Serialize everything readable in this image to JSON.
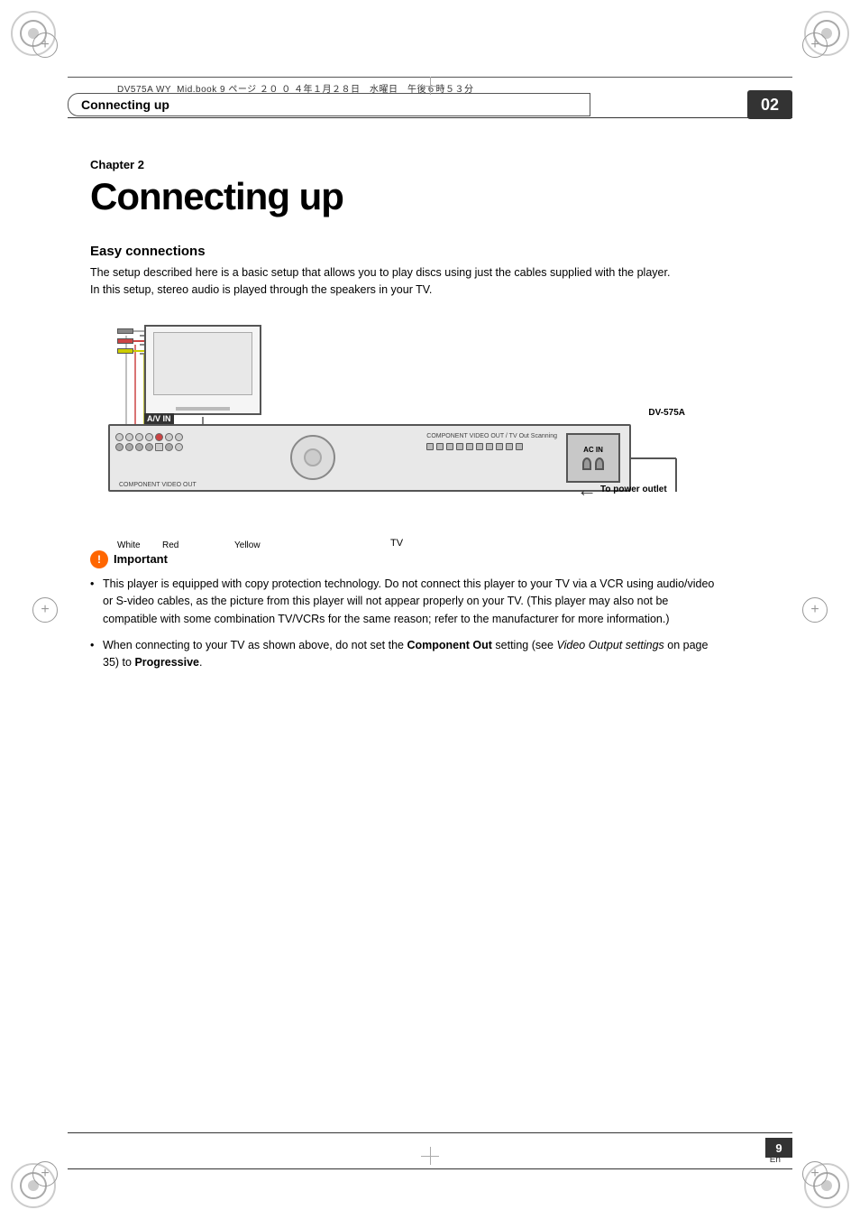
{
  "page": {
    "title": "Connecting up",
    "chapter_label": "Chapter 2",
    "chapter_title": "Connecting up",
    "chapter_number": "02",
    "page_number": "9",
    "page_lang": "En"
  },
  "header": {
    "file_info": "DV575A WY_Mid.book  9 ページ  ２０ ０ ４年１月２８日　水曜日　午後６時５３分",
    "section_title": "Connecting up",
    "chapter_badge": "02"
  },
  "easy_connections": {
    "title": "Easy connections",
    "body": "The setup described here is a basic setup that allows you to play discs using just the cables supplied with the player. In this setup, stereo audio is played through the speakers in your TV."
  },
  "diagram": {
    "tv_label": "TV",
    "av_in_label": "A/V IN",
    "dvd_label": "DV-575A",
    "wire_white": "White",
    "wire_red": "Red",
    "wire_yellow": "Yellow",
    "power_label": "To power\noutlet",
    "ac_in_label": "AC IN"
  },
  "important": {
    "title": "Important",
    "bullet1": "This player is equipped with copy protection technology. Do not connect this player to your TV via a VCR using audio/video or S-video cables, as the picture from this player will not appear properly on your TV. (This player may also not be compatible with some combination TV/VCRs for the same reason; refer to the manufacturer for more information.)",
    "bullet2_pre": "When connecting to your TV as shown above, do not set the ",
    "bullet2_bold": "Component Out",
    "bullet2_mid": " setting (see ",
    "bullet2_italic": "Video Output settings",
    "bullet2_post": " on page 35) to ",
    "bullet2_bold2": "Progressive",
    "bullet2_end": "."
  }
}
